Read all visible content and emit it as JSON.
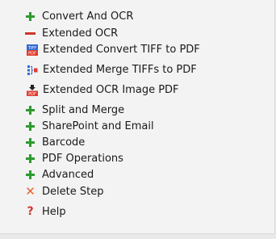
{
  "menu": {
    "convert_ocr": "Convert And OCR",
    "extended_ocr": "Extended OCR",
    "extended_items": [
      {
        "label": "Extended Convert TIFF to PDF"
      },
      {
        "label": "Extended Merge TIFFs to PDF"
      },
      {
        "label": "Extended OCR Image PDF"
      }
    ],
    "split_merge": "Split and Merge",
    "sharepoint_email": "SharePoint and Email",
    "barcode": "Barcode",
    "pdf_operations": "PDF Operations",
    "advanced": "Advanced",
    "delete_step": "Delete Step",
    "help": "Help"
  },
  "icons": {
    "expand": "plus-icon",
    "collapse": "minus-icon",
    "tiff_to_pdf": "tiff-pdf-icon",
    "merge_tiffs": "merge-icon",
    "ocr_pdf": "ocr-pdf-icon",
    "delete": "x-icon",
    "help": "question-icon"
  },
  "colors": {
    "plus": "#2e9b2e",
    "minus": "#d0342c",
    "delete": "#e8632a",
    "help": "#d0342c"
  }
}
